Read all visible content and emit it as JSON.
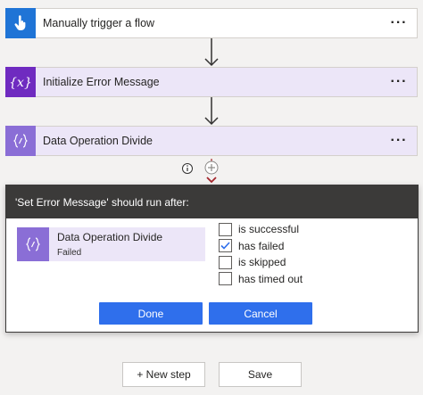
{
  "steps": [
    {
      "title": "Manually trigger a flow",
      "more": "···",
      "icon": "hand-pointer-icon",
      "color": "#1f74d6"
    },
    {
      "title": "Initialize Error Message",
      "more": "···",
      "icon": "variable-icon",
      "color": "#6f2bc0"
    },
    {
      "title": "Data Operation Divide",
      "more": "···",
      "icon": "data-operation-icon",
      "color": "#8a6ed6"
    }
  ],
  "run_after": {
    "header": "'Set Error Message' should run after:",
    "action": {
      "name": "Data Operation Divide",
      "status": "Failed"
    },
    "options": [
      {
        "label": "is successful",
        "checked": false
      },
      {
        "label": "has failed",
        "checked": true
      },
      {
        "label": "is skipped",
        "checked": false
      },
      {
        "label": "has timed out",
        "checked": false
      }
    ],
    "done_label": "Done",
    "cancel_label": "Cancel"
  },
  "footer": {
    "new_step_label": "+ New step",
    "save_label": "Save"
  }
}
